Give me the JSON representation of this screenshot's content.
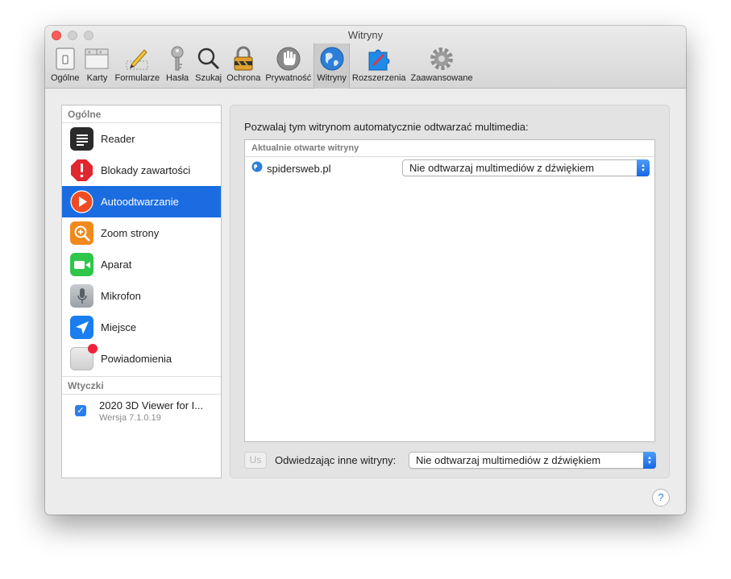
{
  "window": {
    "title": "Witryny"
  },
  "toolbar": {
    "items": [
      {
        "label": "Ogólne",
        "icon": "general-switch-icon"
      },
      {
        "label": "Karty",
        "icon": "tabs-icon"
      },
      {
        "label": "Formularze",
        "icon": "pencil-icon"
      },
      {
        "label": "Hasła",
        "icon": "key-icon"
      },
      {
        "label": "Szukaj",
        "icon": "magnifier-icon"
      },
      {
        "label": "Ochrona",
        "icon": "lock-icon"
      },
      {
        "label": "Prywatność",
        "icon": "hand-icon"
      },
      {
        "label": "Witryny",
        "icon": "globe-icon",
        "selected": true
      },
      {
        "label": "Rozszerzenia",
        "icon": "puzzle-icon"
      },
      {
        "label": "Zaawansowane",
        "icon": "gear-icon"
      }
    ]
  },
  "sidebar": {
    "general_header": "Ogólne",
    "items": [
      {
        "label": "Reader",
        "icon": "reader-icon",
        "color": "#2a2a2a"
      },
      {
        "label": "Blokady zawartości",
        "icon": "stop-sign-icon",
        "color": "#e0262e"
      },
      {
        "label": "Autoodtwarzanie",
        "icon": "play-icon",
        "color": "#f04a22",
        "selected": true
      },
      {
        "label": "Zoom strony",
        "icon": "zoom-icon",
        "color": "#f08a1c"
      },
      {
        "label": "Aparat",
        "icon": "camera-icon",
        "color": "#2fc64a"
      },
      {
        "label": "Mikrofon",
        "icon": "microphone-icon",
        "color": "#9aa0a6"
      },
      {
        "label": "Miejsce",
        "icon": "location-arrow-icon",
        "color": "#1a7ef0"
      },
      {
        "label": "Powiadomienia",
        "icon": "notification-icon",
        "color": "#dadada"
      }
    ],
    "plugins_header": "Wtyczki",
    "plugin": {
      "name": "2020 3D Viewer for I...",
      "version": "Wersja 7.1.0.19"
    }
  },
  "main": {
    "description": "Pozwalaj tym witrynom automatycznie odtwarzać multimedia:",
    "table_header": "Aktualnie otwarte witryny",
    "rows": [
      {
        "site": "spidersweb.pl",
        "setting": "Nie odtwarzaj multimediów z dźwiękiem"
      }
    ],
    "remove_button": "Us",
    "other_label": "Odwiedzając inne witryny:",
    "other_setting": "Nie odtwarzaj multimediów z dźwiękiem"
  },
  "help_label": "?",
  "colors": {
    "accent": "#1b6ce0",
    "close": "#fc5b57"
  }
}
